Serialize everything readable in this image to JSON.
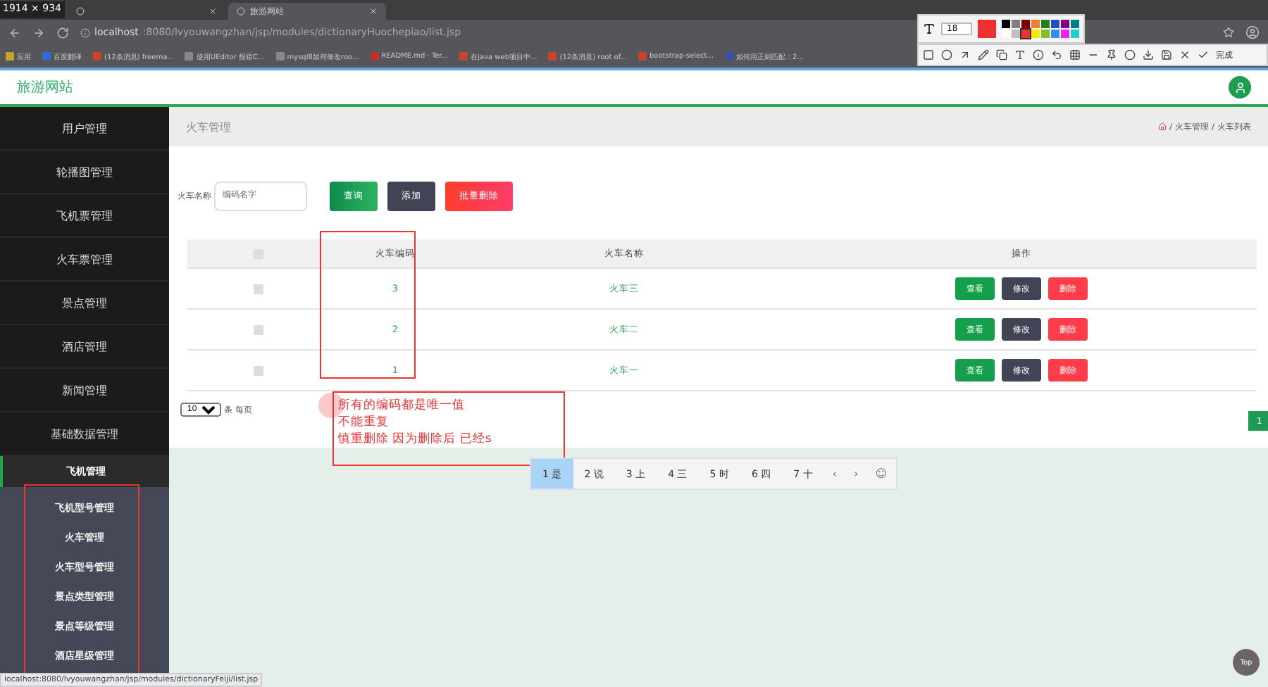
{
  "browser": {
    "size_label": "1914 × 934",
    "tabs": [
      {
        "selected": false
      },
      {
        "title": "旅游网站",
        "selected": true
      }
    ],
    "url_host": "localhost",
    "url_rest": ":8080/lvyouwangzhan/jsp/modules/dictionaryHuochepiao/list.jsp",
    "bookmarks": [
      {
        "label": "应用",
        "color": "#c9a227"
      },
      {
        "label": "百度翻译",
        "color": "#2b6fd6"
      },
      {
        "label": "(12条消息) freema...",
        "color": "#c8452c"
      },
      {
        "label": "使用UEditor 报错C...",
        "color": "#888888"
      },
      {
        "label": "mysql8如何修改roo...",
        "color": "#888888"
      },
      {
        "label": "README.md · Ter...",
        "color": "#c0312c"
      },
      {
        "label": "在java web项目中...",
        "color": "#c8452c"
      },
      {
        "label": "(12条消息) root of...",
        "color": "#c8452c"
      },
      {
        "label": "bootstrap-select...",
        "color": "#c8452c"
      },
      {
        "label": "如何用正则匹配：2...",
        "color": "#3a4fa0"
      }
    ],
    "status_url": "localhost:8080/lvyouwangzhan/jsp/modules/dictionaryFeiji/list.jsp"
  },
  "snip_toolbar": {
    "font_size": "18",
    "palette": [
      {
        "color": "#000000",
        "selected": false
      },
      {
        "color": "#808080",
        "selected": false
      },
      {
        "color": "#800000",
        "selected": false
      },
      {
        "color": "#f08030",
        "selected": false
      },
      {
        "color": "#208020",
        "selected": false
      },
      {
        "color": "#2050c0",
        "selected": false
      },
      {
        "color": "#800080",
        "selected": false
      },
      {
        "color": "#008080",
        "selected": false
      },
      {
        "color": "#ffffff",
        "selected": false
      },
      {
        "color": "#c0c0c0",
        "selected": false
      },
      {
        "color": "#f03030",
        "selected": true
      },
      {
        "color": "#f0f000",
        "selected": false
      },
      {
        "color": "#80c020",
        "selected": false
      },
      {
        "color": "#3090f0",
        "selected": false
      },
      {
        "color": "#f020f0",
        "selected": false
      },
      {
        "color": "#20d0d0",
        "selected": false
      }
    ],
    "done": "完成"
  },
  "site": {
    "title": "旅游网站"
  },
  "sidebar": {
    "items": [
      {
        "label": "用户管理"
      },
      {
        "label": "轮播图管理"
      },
      {
        "label": "飞机票管理"
      },
      {
        "label": "火车票管理"
      },
      {
        "label": "景点管理"
      },
      {
        "label": "酒店管理"
      },
      {
        "label": "新闻管理"
      },
      {
        "label": "基础数据管理"
      }
    ],
    "group": {
      "label": "飞机管理",
      "expanded": true,
      "children": [
        {
          "label": "飞机型号管理"
        },
        {
          "label": "火车管理"
        },
        {
          "label": "火车型号管理"
        },
        {
          "label": "景点类型管理"
        },
        {
          "label": "景点等级管理"
        },
        {
          "label": "酒店星级管理"
        }
      ]
    }
  },
  "page": {
    "title": "火车管理",
    "breadcrumb": [
      "火车管理",
      "火车列表"
    ],
    "breadcrumb_separator": "/",
    "search": {
      "label": "火车名称",
      "placeholder": "编码名字"
    },
    "buttons": [
      {
        "label": "查询",
        "kind": "primary"
      },
      {
        "label": "添加",
        "kind": "dark"
      },
      {
        "label": "批量删除",
        "kind": "danger"
      }
    ],
    "table": {
      "select_all_checked": false,
      "columns": [
        "火车编码",
        "火车名称",
        "操作"
      ],
      "rows": [
        {
          "code": "3",
          "name": "火车三",
          "checked": false,
          "actions": [
            "查看",
            "修改",
            "删除"
          ]
        },
        {
          "code": "2",
          "name": "火车二",
          "checked": false,
          "actions": [
            "查看",
            "修改",
            "删除"
          ]
        },
        {
          "code": "1",
          "name": "火车一",
          "checked": false,
          "actions": [
            "查看",
            "修改",
            "删除"
          ]
        }
      ]
    },
    "page_size": "10",
    "page_size_label": "条 每页",
    "pages": [
      {
        "label": "1",
        "selected": true
      }
    ]
  },
  "annotation": {
    "lines": [
      "所有的编码都是唯一值",
      "不能重复",
      "慎重删除 因为删除后  已经s"
    ]
  },
  "ime": {
    "candidates": [
      {
        "label": "1 是",
        "selected": true
      },
      {
        "label": "2 说",
        "selected": false
      },
      {
        "label": "3 上",
        "selected": false
      },
      {
        "label": "4 三",
        "selected": false
      },
      {
        "label": "5 时",
        "selected": false
      },
      {
        "label": "6 四",
        "selected": false
      },
      {
        "label": "7 十",
        "selected": false
      }
    ],
    "prev": "‹",
    "next": "›",
    "emoji": "☺"
  },
  "top_button": "Top"
}
